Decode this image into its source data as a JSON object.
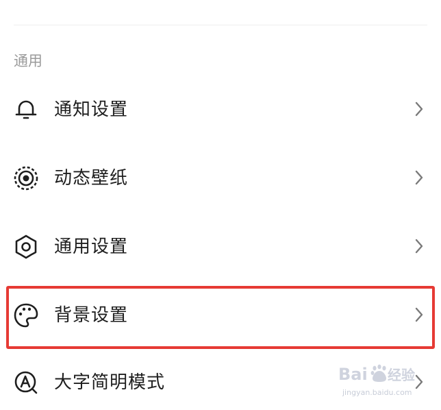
{
  "section": {
    "title": "通用"
  },
  "items": [
    {
      "label": "通知设置",
      "icon": "bell-icon"
    },
    {
      "label": "动态壁纸",
      "icon": "live-wallpaper-icon"
    },
    {
      "label": "通用设置",
      "icon": "gear-icon"
    },
    {
      "label": "背景设置",
      "icon": "palette-icon",
      "highlighted": true
    },
    {
      "label": "大字简明模式",
      "icon": "large-font-mode-icon"
    }
  ],
  "highlight_color": "#e63a34",
  "watermark": {
    "brand": "Bai du 经验",
    "url": "jingyan.baidu.com"
  }
}
